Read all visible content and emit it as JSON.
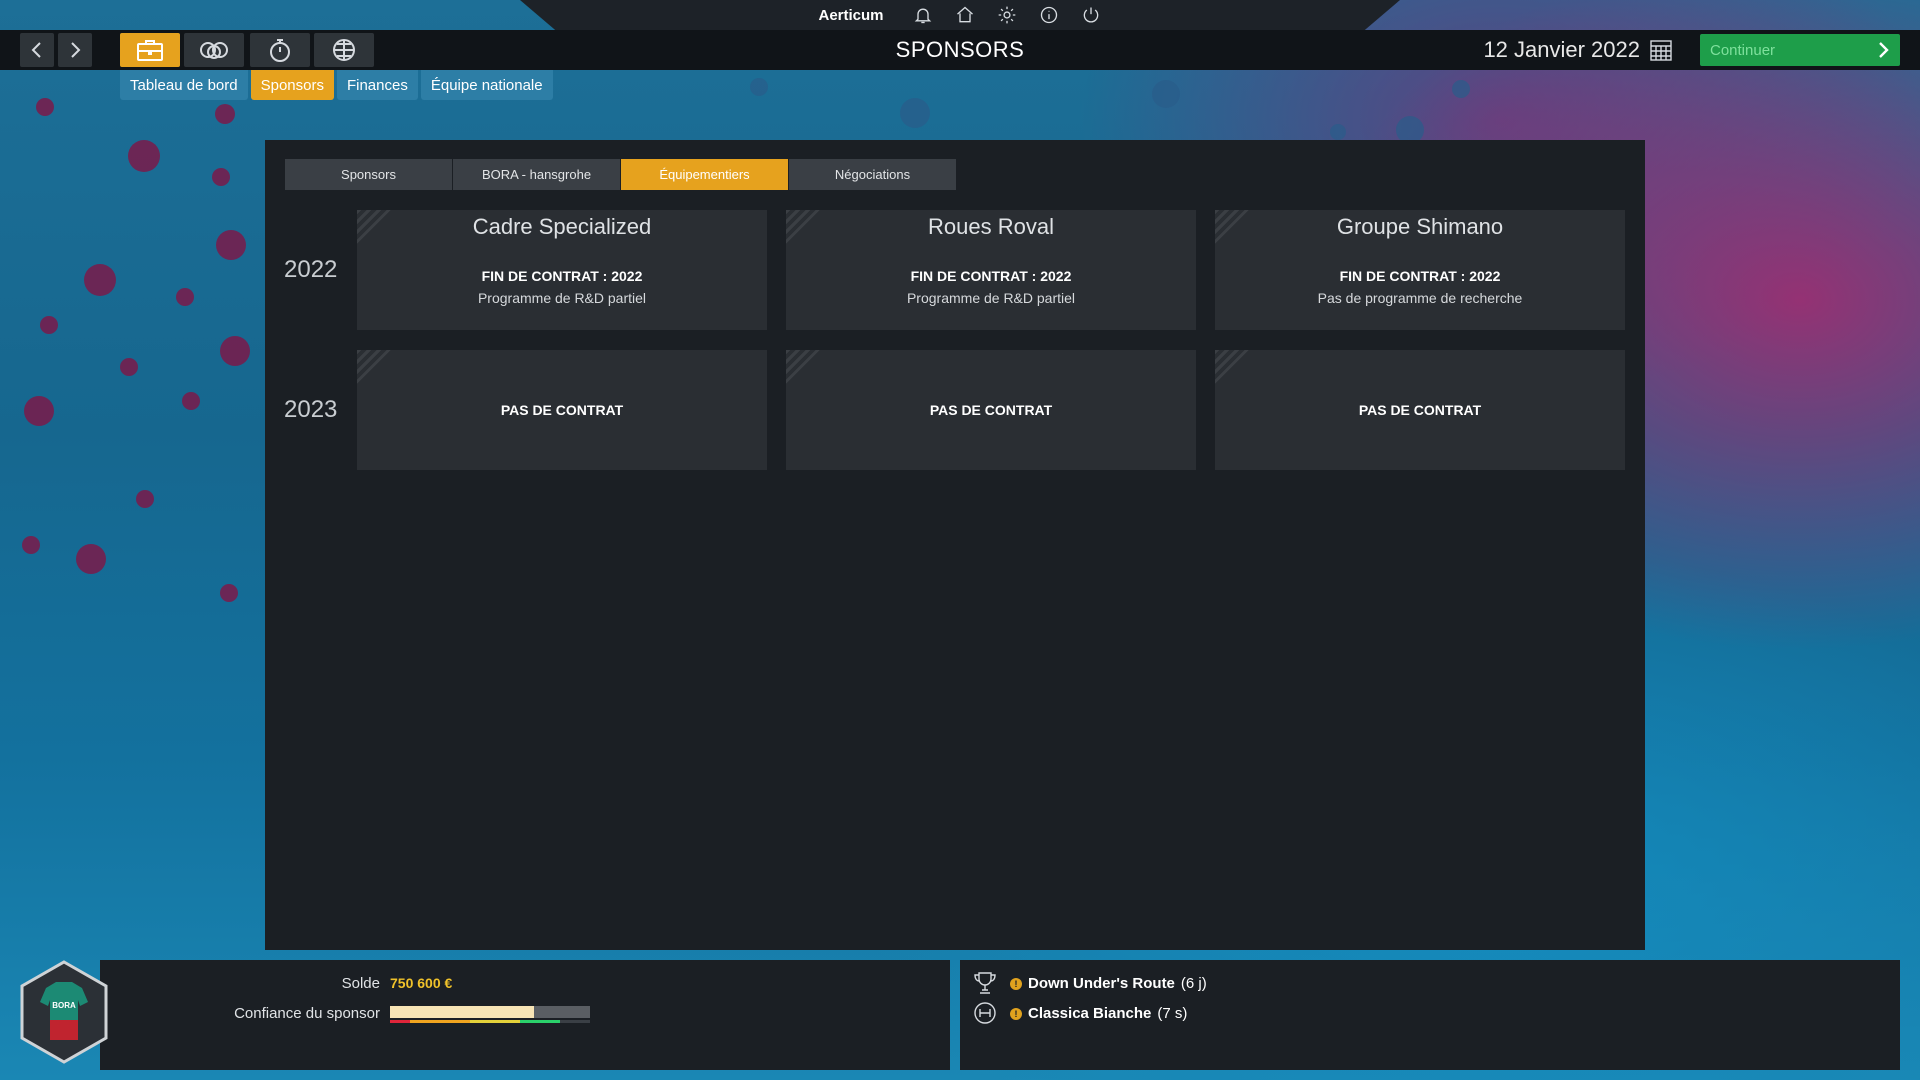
{
  "topbar": {
    "user": "Aerticum",
    "icons": [
      "bell-icon",
      "home-icon",
      "gear-icon",
      "info-icon",
      "power-icon"
    ]
  },
  "nav": {
    "title": "SPONSORS",
    "date": "12 Janvier 2022",
    "continue_label": "Continuer",
    "icons": [
      "back-arrow-icon",
      "forward-arrow-icon",
      "briefcase-icon",
      "team-icon",
      "stopwatch-icon",
      "globe-icon"
    ]
  },
  "subtabs": [
    "Tableau de bord",
    "Sponsors",
    "Finances",
    "Équipe nationale"
  ],
  "inner_tabs": [
    "Sponsors",
    "BORA - hansgrohe",
    "Équipementiers",
    "Négociations"
  ],
  "rows": [
    {
      "year": "2022",
      "cards": [
        {
          "title": "Cadre Specialized",
          "contract": "FIN DE CONTRAT : 2022",
          "program": "Programme de R&D partiel"
        },
        {
          "title": "Roues Roval",
          "contract": "FIN DE CONTRAT : 2022",
          "program": "Programme de R&D partiel"
        },
        {
          "title": "Groupe Shimano",
          "contract": "FIN DE CONTRAT : 2022",
          "program": "Pas de programme de recherche"
        }
      ]
    },
    {
      "year": "2023",
      "cards": [
        {
          "empty": "PAS DE CONTRAT"
        },
        {
          "empty": "PAS DE CONTRAT"
        },
        {
          "empty": "PAS DE CONTRAT"
        }
      ]
    }
  ],
  "bottom": {
    "balance_label": "Solde",
    "balance_value": "750 600 €",
    "confidence_label": "Confiance du sponsor",
    "confidence_level": 0.72,
    "races": [
      {
        "icon": "trophy-icon",
        "name": "Down Under's Route",
        "time": "(6 j)"
      },
      {
        "icon": "race-icon",
        "name": "Classica Bianche",
        "time": "(7 s)"
      }
    ]
  }
}
